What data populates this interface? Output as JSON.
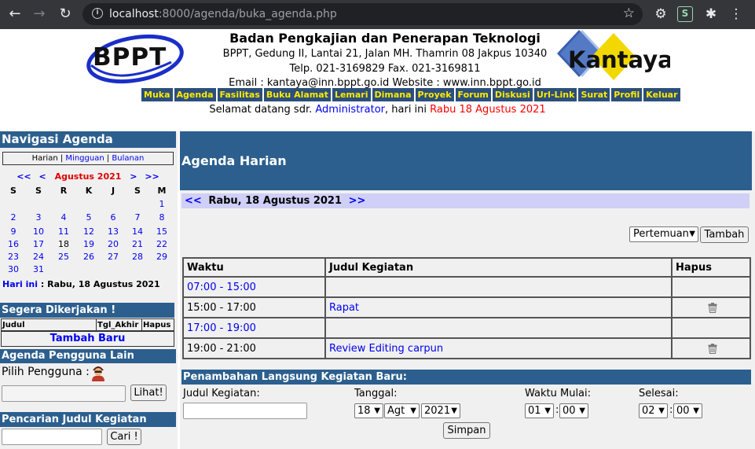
{
  "browser": {
    "url_host": "localhost",
    "url_path": ":8000/agenda/buka_agenda.php"
  },
  "header": {
    "bppt_logo_text": "BPPT",
    "kantaya_logo_text": "Kantaya",
    "org_name": "Badan Pengkajian dan Penerapan Teknologi",
    "address": "BPPT, Gedung II, Lantai 21, Jalan MH. Thamrin 08 Jakpus 10340",
    "phone": "Telp. 021-3169829 Fax. 021-3169811",
    "contact": "Email : kantaya@inn.bppt.go.id Website : www.inn.bppt.go.id",
    "menu": [
      "Muka",
      "Agenda",
      "Fasilitas",
      "Buku Alamat",
      "Lemari",
      "Dimana",
      "Proyek",
      "Forum",
      "Diskusi",
      "Url-Link",
      "Surat",
      "Profil",
      "Keluar"
    ],
    "welcome_prefix": "Selamat datang sdr. ",
    "welcome_user": "Administrator",
    "welcome_mid": ", hari ini ",
    "welcome_date": "Rabu 18 Agustus 2021"
  },
  "left": {
    "nav_title": "Navigasi Agenda",
    "view_current": "Harian",
    "view_week": "Mingguan",
    "view_month": "Bulanan",
    "sep": "|",
    "cal_prev_year": "<<",
    "cal_prev_month": "<",
    "cal_month": "Agustus 2021",
    "cal_next_month": ">",
    "cal_next_year": ">>",
    "weekdays": [
      "S",
      "S",
      "R",
      "K",
      "J",
      "S",
      "M"
    ],
    "today_link": "Hari ini",
    "today_text": ": Rabu, 18 Agustus 2021",
    "todo_title": "Segera Dikerjakan !",
    "todo_cols": [
      "Judul",
      "Tgl_Akhir",
      "Hapus"
    ],
    "todo_add": "Tambah Baru",
    "other_title": "Agenda Pengguna Lain",
    "pick_label": "Pilih Pengguna :",
    "lihat_btn": "Lihat!",
    "search_title": "Pencarian Judul Kegiatan",
    "cari_btn": "Cari !"
  },
  "main": {
    "title": "Agenda Harian",
    "prev": "<<",
    "date": "Rabu, 18 Agustus 2021",
    "next": ">>",
    "type_selected": "Pertemuan",
    "tambah_btn": "Tambah",
    "table_cols": [
      "Waktu",
      "Judul Kegiatan",
      "Hapus"
    ],
    "rows": [
      {
        "time": "07:00 - 15:00",
        "time_link": true,
        "title": "",
        "deletable": false
      },
      {
        "time": "15:00 - 17:00",
        "time_link": false,
        "title": "Rapat",
        "deletable": true
      },
      {
        "time": "17:00 - 19:00",
        "time_link": true,
        "title": "",
        "deletable": false
      },
      {
        "time": "19:00 - 21:00",
        "time_link": false,
        "title": "Review Editing carpun",
        "deletable": true
      }
    ],
    "quick_title": "Penambahan Langsung Kegiatan Baru:",
    "label_judul": "Judul Kegiatan:",
    "label_tanggal": "Tanggal:",
    "label_mulai": "Waktu Mulai:",
    "label_selesai": "Selesai:",
    "sel_day": "18",
    "sel_month": "Agt",
    "sel_year": "2021",
    "sel_start_h": "01",
    "sel_start_m": "00",
    "sel_end_h": "02",
    "sel_end_m": "00",
    "colon": ":",
    "simpan_btn": "Simpan"
  },
  "colors": {
    "section_blue": "#2c5f8e",
    "menu_yellow": "#ffea00",
    "date_bar": "#cfcff7",
    "link": "#0000ee",
    "red": "#ff0000"
  }
}
